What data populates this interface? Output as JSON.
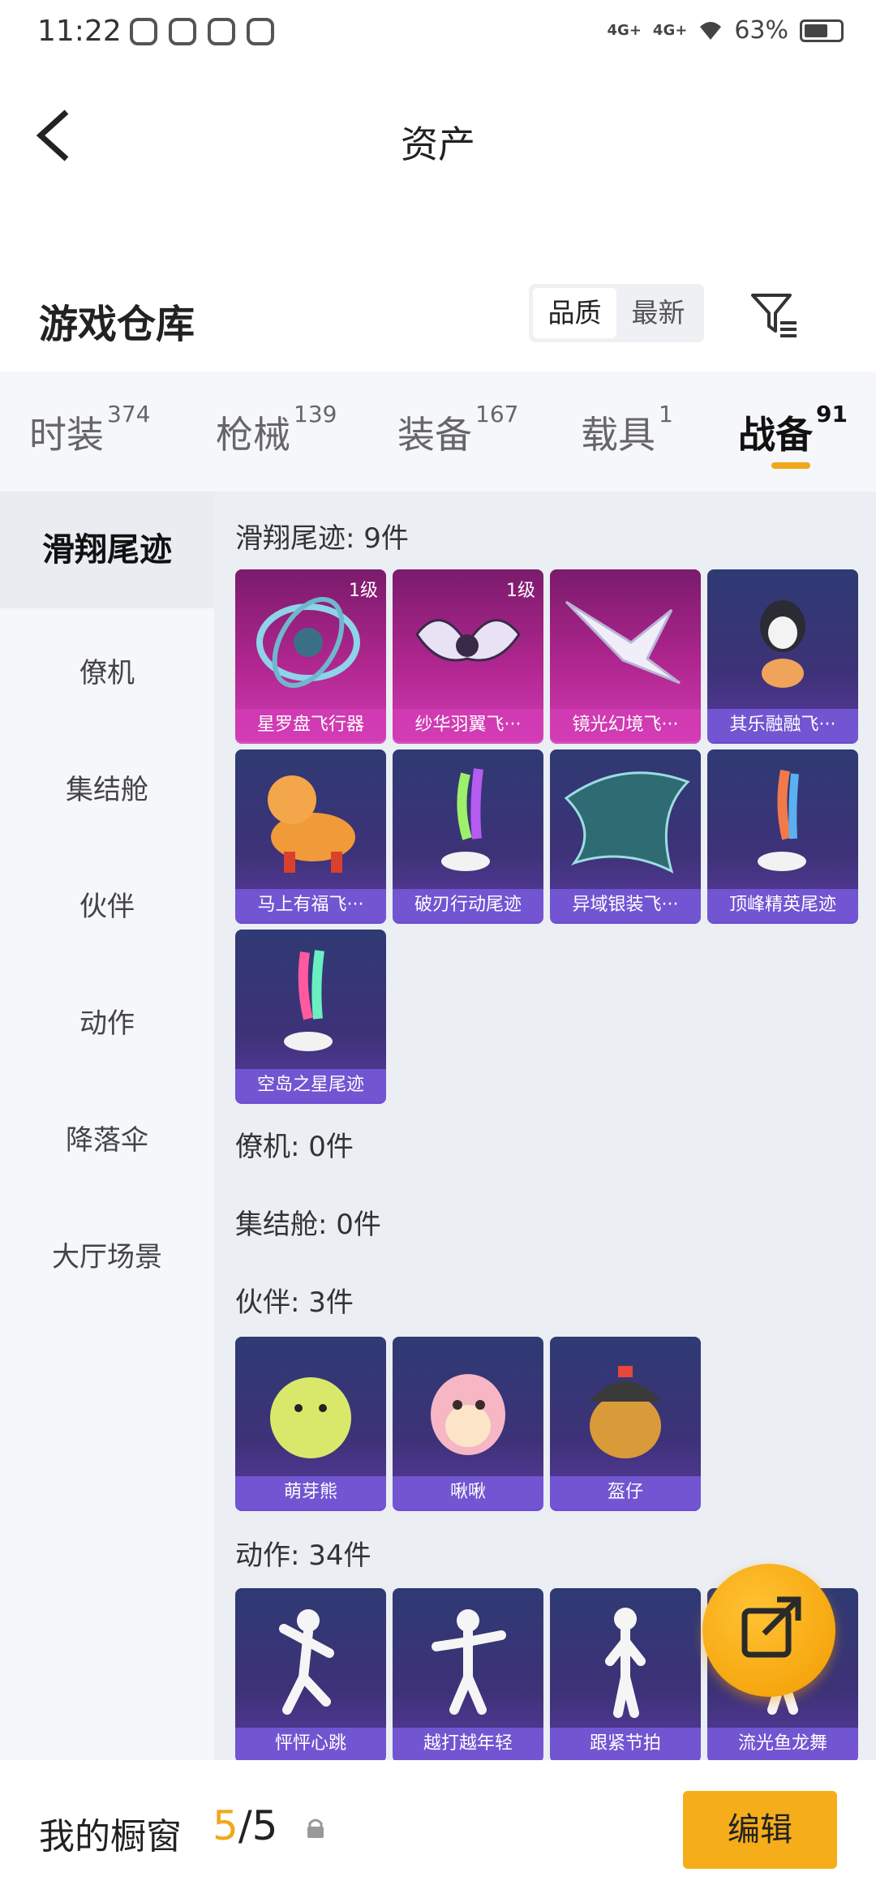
{
  "status": {
    "time": "11:22",
    "net1": "4G+",
    "net2": "4G+",
    "battery": "63%"
  },
  "topbar": {
    "title": "资产"
  },
  "warehouse": {
    "title": "游戏仓库",
    "sort": [
      "品质",
      "最新"
    ],
    "active_sort": 0
  },
  "tabs": [
    {
      "label": "时装",
      "count": "374"
    },
    {
      "label": "枪械",
      "count": "139"
    },
    {
      "label": "装备",
      "count": "167"
    },
    {
      "label": "载具",
      "count": "1"
    },
    {
      "label": "战备",
      "count": "91"
    }
  ],
  "sidebar": {
    "items": [
      "滑翔尾迹",
      "僚机",
      "集结舱",
      "伙伴",
      "动作",
      "降落伞",
      "大厅场景"
    ]
  },
  "groups": {
    "glide": "滑翔尾迹: 9件",
    "wingman": "僚机: 0件",
    "pod": "集结舱: 0件",
    "partner": "伙伴: 3件",
    "emote": "动作: 34件"
  },
  "glide_items": [
    {
      "name": "星罗盘飞行器",
      "level": "1级"
    },
    {
      "name": "纱华羽翼飞···",
      "level": "1级"
    },
    {
      "name": "镜光幻境飞···"
    },
    {
      "name": "其乐融融飞···"
    },
    {
      "name": "马上有福飞···"
    },
    {
      "name": "破刃行动尾迹"
    },
    {
      "name": "异域银装飞···"
    },
    {
      "name": "顶峰精英尾迹"
    },
    {
      "name": "空岛之星尾迹"
    }
  ],
  "partner_items": [
    {
      "name": "萌芽熊"
    },
    {
      "name": "啾啾"
    },
    {
      "name": "盔仔"
    }
  ],
  "emote_items": [
    {
      "name": "怦怦心跳"
    },
    {
      "name": "越打越年轻"
    },
    {
      "name": "跟紧节拍"
    },
    {
      "name": "流光鱼龙舞"
    }
  ],
  "bottom": {
    "label": "我的橱窗",
    "current": "5",
    "sep_total": "/5",
    "edit": "编辑"
  },
  "colors": {
    "accent": "#f2a81b",
    "card_purple": "#3d3278",
    "card_pink": "#b0268f"
  }
}
